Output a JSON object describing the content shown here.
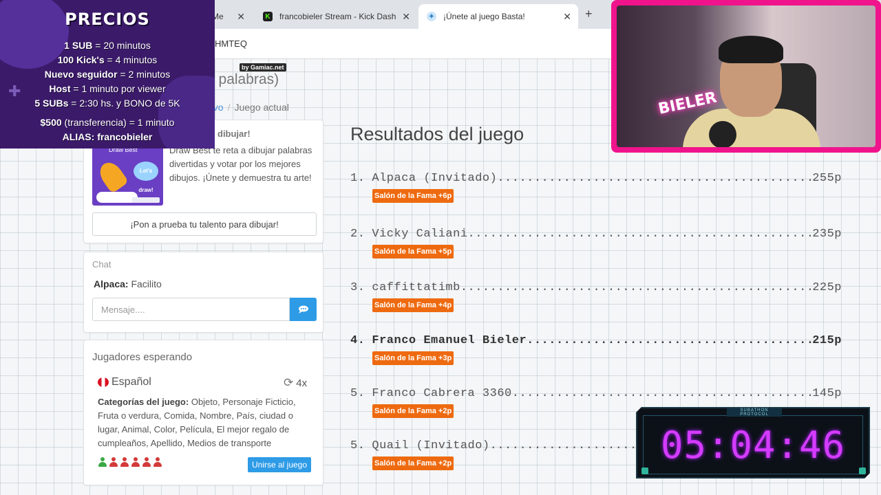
{
  "browser": {
    "tabs": [
      {
        "label": "Me",
        "icon": "page-icon"
      },
      {
        "label": "francobieler Stream - Kick Dash",
        "icon": "kick-icon"
      },
      {
        "label": "¡Únete al juego Basta!",
        "icon": "game-icon"
      }
    ],
    "address_fragment": "HMTEQ"
  },
  "page": {
    "title_fragment": "e palabras)",
    "gamiac_tag": "by Gamiac.net",
    "breadcrumb_link": "evo",
    "breadcrumb_sep": "/",
    "breadcrumb_current": "Juego actual"
  },
  "promo": {
    "title": "dibujar!",
    "image_label": "Draw Best",
    "bubble_text": "Let's draw!",
    "text": "Draw Best te reta a dibujar palabras divertidas y votar por los mejores dibujos. ¡Únete y demuestra tu arte!",
    "button": "¡Pon a prueba tu talento para dibujar!"
  },
  "chat": {
    "title": "Chat",
    "message_user": "Alpaca:",
    "message_text": "Facilito",
    "input_placeholder": "Mensaje...."
  },
  "waiting": {
    "title": "Jugadores esperando",
    "language": "Español",
    "rounds": "4x",
    "categories_label": "Categorías del juego:",
    "categories_text": "Objeto, Personaje Ficticio, Fruta o verdura, Comida, Nombre, País, ciudad o lugar, Animal, Color, Película, El mejor regalo de cumpleaños, Apellido, Medios de transporte",
    "avatar_colors": [
      "#3aa845",
      "#d33a3a",
      "#d33a3a",
      "#d33a3a",
      "#d33a3a",
      "#d33a3a"
    ],
    "join_button": "Unirse al juego"
  },
  "results": {
    "title": "Resultados del juego",
    "rows": [
      {
        "rank": "1.",
        "name": "Alpaca (Invitado)",
        "score": "255p",
        "badge": "Salón de la Fama +6p",
        "mine": false
      },
      {
        "rank": "2.",
        "name": "Vicky Caliani",
        "score": "235p",
        "badge": "Salón de la Fama +5p",
        "mine": false
      },
      {
        "rank": "3.",
        "name": "caffittatimb",
        "score": "225p",
        "badge": "Salón de la Fama +4p",
        "mine": false
      },
      {
        "rank": "4.",
        "name": "Franco Emanuel Bieler",
        "score": "215p",
        "badge": "Salón de la Fama +3p",
        "mine": true
      },
      {
        "rank": "5.",
        "name": "Franco Cabrera 3360",
        "score": "145p",
        "badge": "Salón de la Fama +2p",
        "mine": false
      },
      {
        "rank": "5.",
        "name": "Quail (Invitado)",
        "score": "",
        "badge": "Salón de la Fama +2p",
        "mine": false
      }
    ],
    "badge_color": "#ee6a10"
  },
  "overlay": {
    "prices_title": "PRECIOS",
    "prices_lines": [
      {
        "bold": "1 SUB",
        "rest": " = 20 minutos"
      },
      {
        "bold": "100 Kick's",
        "rest": " = 4 minutos"
      },
      {
        "bold": "Nuevo seguidor",
        "rest": " = 2 minutos"
      },
      {
        "bold": "Host",
        "rest": " = 1 minuto por viewer"
      },
      {
        "bold": "5 SUBs",
        "rest": " = 2:30 hs. y BONO de 5K"
      },
      {
        "bold": "$500",
        "rest": " (transferencia) = 1 minuto"
      },
      {
        "bold": "ALIAS: francobieler",
        "rest": ""
      }
    ],
    "webcam_neon": "BIELER",
    "timer_label": "SUBATHON PROTOCOL",
    "timer": "05:04:46",
    "accent_color": "#f0148c"
  }
}
